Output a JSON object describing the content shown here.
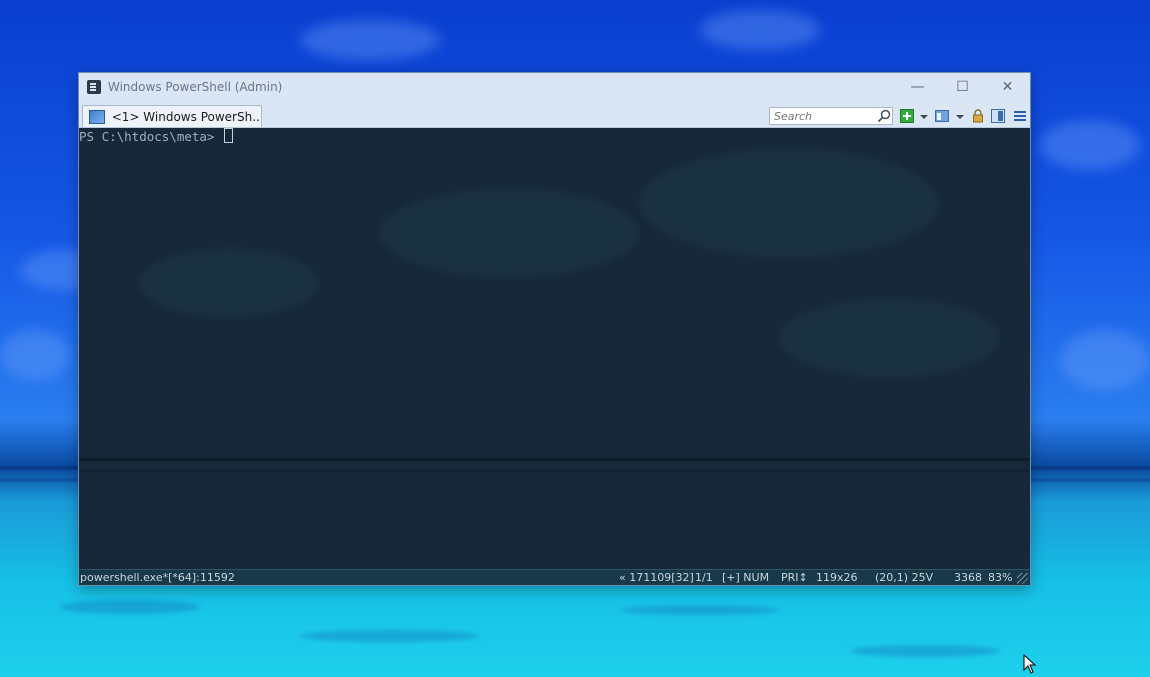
{
  "window": {
    "title": "Windows PowerShell (Admin)",
    "controls": {
      "minimize": "—",
      "maximize": "☐",
      "close": "✕"
    }
  },
  "tabs": [
    {
      "label": "<1> Windows PowerSh...",
      "icon": "powershell-tab-icon",
      "active": true
    }
  ],
  "toolbar": {
    "search_placeholder": "Search",
    "icons": [
      "search-icon",
      "new-console-icon",
      "dropdown-icon",
      "panes-icon",
      "dropdown-icon",
      "lock-icon",
      "split-view-icon",
      "menu-icon"
    ]
  },
  "console": {
    "prompt": "PS C:\\htdocs\\meta> "
  },
  "status": {
    "process": "powershell.exe*[*64]:11592",
    "position": "« 171109[32]",
    "page": "1/1",
    "flags": "[+] NUM",
    "priority": "PRI↕",
    "size": "119x26",
    "cursor": "(20,1) 25V",
    "count": "3368",
    "zoom": "83%"
  },
  "colors": {
    "titlebar": "#dbe6f5",
    "console_bg": "#16283a",
    "statusbar": "#17394a",
    "accent_green": "#2fae3a"
  }
}
